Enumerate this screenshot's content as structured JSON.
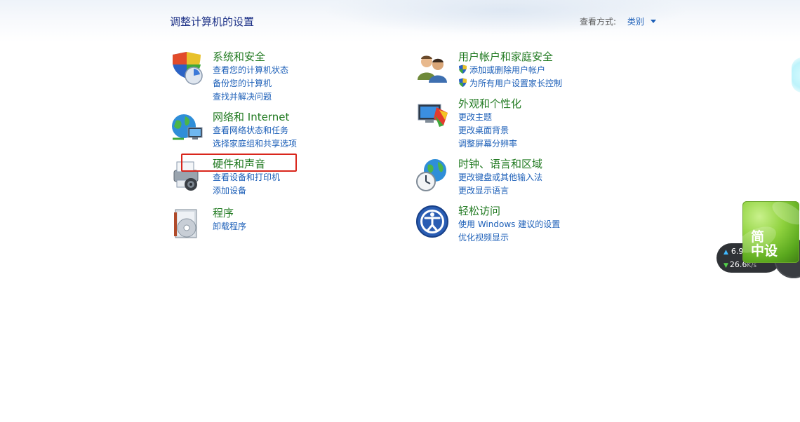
{
  "header": {
    "title": "调整计算机的设置",
    "view_by_label": "查看方式:",
    "view_by_value": "类别"
  },
  "categories": [
    {
      "title": "系统和安全",
      "links": [
        "查看您的计算机状态",
        "备份您的计算机",
        "查找并解决问题"
      ],
      "icon": "system-security-icon"
    },
    {
      "title": "网络和 Internet",
      "links": [
        "查看网络状态和任务",
        "选择家庭组和共享选项"
      ],
      "icon": "network-internet-icon"
    },
    {
      "title": "硬件和声音",
      "links": [
        "查看设备和打印机",
        "添加设备"
      ],
      "icon": "hardware-sound-icon"
    },
    {
      "title": "程序",
      "links": [
        "卸载程序"
      ],
      "icon": "programs-icon"
    },
    {
      "title": "用户帐户和家庭安全",
      "links": [
        "添加或删除用户帐户",
        "为所有用户设置家长控制"
      ],
      "icon": "user-accounts-icon"
    },
    {
      "title": "外观和个性化",
      "links": [
        "更改主题",
        "更改桌面背景",
        "调整屏幕分辨率"
      ],
      "icon": "appearance-icon"
    },
    {
      "title": "时钟、语言和区域",
      "links": [
        "更改键盘或其他输入法",
        "更改显示语言"
      ],
      "icon": "clock-language-icon"
    },
    {
      "title": "轻松访问",
      "links": [
        "使用 Windows 建议的设置",
        "优化视频显示"
      ],
      "icon": "ease-of-access-icon"
    }
  ],
  "widgets": {
    "net_speed_up": "6.9",
    "net_speed_down": "26.6",
    "net_speed_unit": "K/s",
    "ime_line1": "简",
    "ime_line2": "中设"
  },
  "colors": {
    "title_blue": "#1e3287",
    "category_green": "#217a21",
    "link_blue": "#1c5fb8",
    "highlight_red": "#d9261c"
  }
}
